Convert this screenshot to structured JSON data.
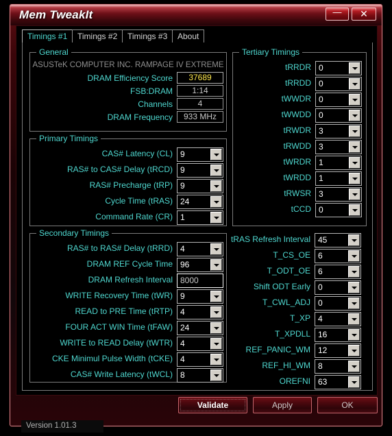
{
  "window": {
    "title": "Mem TweakIt",
    "minimize_label": "—",
    "close_label": "✕"
  },
  "tabs": [
    {
      "label": "Timings #1",
      "active": true
    },
    {
      "label": "Timings #2",
      "active": false
    },
    {
      "label": "Timings #3",
      "active": false
    },
    {
      "label": "About",
      "active": false
    }
  ],
  "general": {
    "group_label": "General",
    "board_name": "ASUSTeK COMPUTER INC. RAMPAGE IV EXTREME",
    "rows": [
      {
        "label": "DRAM Efficiency Score",
        "value": "37689",
        "kind": "score"
      },
      {
        "label": "FSB:DRAM",
        "value": "1:14",
        "kind": "ro"
      },
      {
        "label": "Channels",
        "value": "4",
        "kind": "ro"
      },
      {
        "label": "DRAM Frequency",
        "value": "933 MHz",
        "kind": "ro"
      }
    ]
  },
  "primary": {
    "group_label": "Primary Timings",
    "rows": [
      {
        "label": "CAS# Latency (CL)",
        "value": "9",
        "kind": "combo"
      },
      {
        "label": "RAS# to CAS# Delay (tRCD)",
        "value": "9",
        "kind": "combo"
      },
      {
        "label": "RAS# Precharge (tRP)",
        "value": "9",
        "kind": "combo"
      },
      {
        "label": "Cycle Time (tRAS)",
        "value": "24",
        "kind": "combo"
      },
      {
        "label": "Command Rate (CR)",
        "value": "1",
        "kind": "combo"
      }
    ]
  },
  "secondary": {
    "group_label": "Secondary Timings",
    "rows": [
      {
        "label": "RAS# to RAS# Delay (tRRD)",
        "value": "4",
        "kind": "combo"
      },
      {
        "label": "DRAM REF Cycle Time",
        "value": "96",
        "kind": "combo"
      },
      {
        "label": "DRAM Refresh Interval",
        "value": "8000",
        "kind": "text"
      },
      {
        "label": "WRITE Recovery Time (tWR)",
        "value": "9",
        "kind": "combo"
      },
      {
        "label": "READ to PRE Time (tRTP)",
        "value": "4",
        "kind": "combo"
      },
      {
        "label": "FOUR ACT WIN Time (tFAW)",
        "value": "24",
        "kind": "combo"
      },
      {
        "label": "WRITE to READ Delay (tWTR)",
        "value": "4",
        "kind": "combo"
      },
      {
        "label": "CKE Minimul Pulse Width (tCKE)",
        "value": "4",
        "kind": "combo"
      },
      {
        "label": "CAS# Write Latency (tWCL)",
        "value": "8",
        "kind": "combo"
      }
    ]
  },
  "tertiary": {
    "group_label": "Tertiary Timings",
    "rows": [
      {
        "label": "tRRDR",
        "value": "0",
        "kind": "combo"
      },
      {
        "label": "tRRDD",
        "value": "0",
        "kind": "combo"
      },
      {
        "label": "tWWDR",
        "value": "0",
        "kind": "combo"
      },
      {
        "label": "tWWDD",
        "value": "0",
        "kind": "combo"
      },
      {
        "label": "tRWDR",
        "value": "3",
        "kind": "combo"
      },
      {
        "label": "tRWDD",
        "value": "3",
        "kind": "combo"
      },
      {
        "label": "tWRDR",
        "value": "1",
        "kind": "combo"
      },
      {
        "label": "tWRDD",
        "value": "1",
        "kind": "combo"
      },
      {
        "label": "tRWSR",
        "value": "3",
        "kind": "combo"
      },
      {
        "label": "tCCD",
        "value": "0",
        "kind": "combo"
      }
    ]
  },
  "extended": {
    "rows": [
      {
        "label": "tRAS Refresh Interval",
        "value": "45",
        "kind": "combo"
      },
      {
        "label": "T_CS_OE",
        "value": "6",
        "kind": "combo"
      },
      {
        "label": "T_ODT_OE",
        "value": "6",
        "kind": "combo"
      },
      {
        "label": "Shift ODT Early",
        "value": "0",
        "kind": "combo"
      },
      {
        "label": "T_CWL_ADJ",
        "value": "0",
        "kind": "combo"
      },
      {
        "label": "T_XP",
        "value": "4",
        "kind": "combo"
      },
      {
        "label": "T_XPDLL",
        "value": "16",
        "kind": "combo"
      },
      {
        "label": "REF_PANIC_WM",
        "value": "12",
        "kind": "combo"
      },
      {
        "label": "REF_HI_WM",
        "value": "8",
        "kind": "combo"
      },
      {
        "label": "OREFNI",
        "value": "63",
        "kind": "combo"
      }
    ]
  },
  "buttons": {
    "validate": "Validate",
    "apply": "Apply",
    "ok": "OK"
  },
  "statusbar": {
    "version": "Version 1.01.3"
  },
  "colors": {
    "accent_cyan": "#4fd8d0",
    "score_yellow": "#ffe94d",
    "frame_red": "#b41b22"
  }
}
